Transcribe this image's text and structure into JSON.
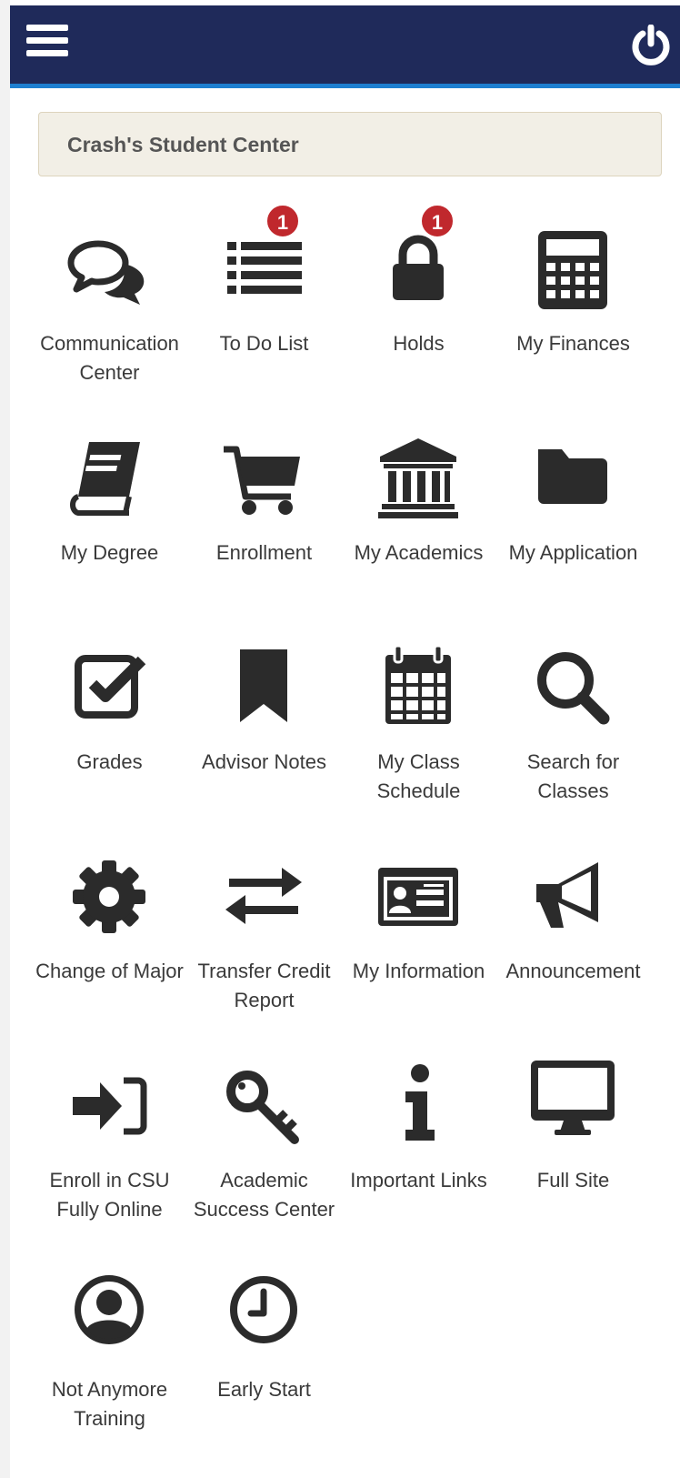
{
  "header": {
    "menu_icon": "hamburger-menu-icon",
    "power_icon": "power-icon"
  },
  "student_center": {
    "title": "Crash's Student Center"
  },
  "tiles": [
    {
      "label": "Communication Center",
      "icon": "chat-bubbles-icon"
    },
    {
      "label": "To Do List",
      "icon": "list-icon",
      "badge": "1"
    },
    {
      "label": "Holds",
      "icon": "lock-icon",
      "badge": "1"
    },
    {
      "label": "My Finances",
      "icon": "calculator-icon"
    },
    {
      "label": "My Degree",
      "icon": "book-icon"
    },
    {
      "label": "Enrollment",
      "icon": "cart-icon"
    },
    {
      "label": "My Academics",
      "icon": "institution-icon"
    },
    {
      "label": "My Application",
      "icon": "folder-icon"
    },
    {
      "label": "Grades",
      "icon": "checkbox-icon"
    },
    {
      "label": "Advisor Notes",
      "icon": "bookmark-icon"
    },
    {
      "label": "My Class Schedule",
      "icon": "calendar-icon"
    },
    {
      "label": "Search for Classes",
      "icon": "search-icon"
    },
    {
      "label": "Change of Major",
      "icon": "gear-icon"
    },
    {
      "label": "Transfer Credit Report",
      "icon": "exchange-arrows-icon"
    },
    {
      "label": "My Information",
      "icon": "id-card-icon"
    },
    {
      "label": "Announcement",
      "icon": "megaphone-icon"
    },
    {
      "label": "Enroll in CSU Fully Online",
      "icon": "sign-in-icon"
    },
    {
      "label": "Academic Success Center",
      "icon": "key-icon"
    },
    {
      "label": "Important Links",
      "icon": "info-icon"
    },
    {
      "label": "Full Site",
      "icon": "desktop-icon"
    },
    {
      "label": "Not Anymore Training",
      "icon": "user-circle-icon"
    },
    {
      "label": "Early Start",
      "icon": "clock-icon"
    }
  ]
}
